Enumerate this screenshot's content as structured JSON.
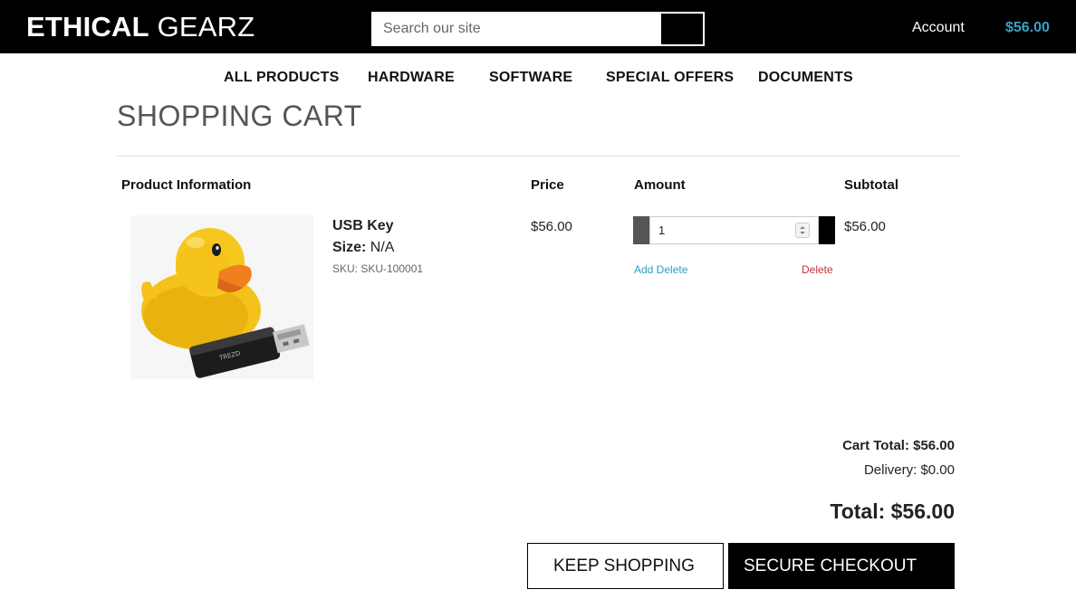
{
  "header": {
    "logo_bold": "ETHICAL",
    "logo_light": "GEARZ",
    "search_placeholder": "Search our site",
    "account_label": "Account",
    "cart_total": "$56.00",
    "accent_color": "#3aa3c4"
  },
  "nav": {
    "items": [
      {
        "label": "ALL PRODUCTS"
      },
      {
        "label": "HARDWARE"
      },
      {
        "label": "SOFTWARE"
      },
      {
        "label": "SPECIAL OFFERS"
      },
      {
        "label": "DOCUMENTS"
      }
    ]
  },
  "page": {
    "title": "SHOPPING CART"
  },
  "table": {
    "headers": {
      "product": "Product Information",
      "price": "Price",
      "amount": "Amount",
      "subtotal": "Subtotal"
    },
    "rows": [
      {
        "name": "USB Key",
        "size_label": "Size:",
        "size_value": "N/A",
        "sku": "SKU: SKU-100001",
        "price": "$56.00",
        "quantity": "1",
        "subtotal": "$56.00",
        "add_delete_label": "Add Delete",
        "delete_label": "Delete",
        "image_icon": "rubber-duck-usb-key-image"
      }
    ]
  },
  "totals": {
    "cart_total": "Cart Total: $56.00",
    "delivery": "Delivery: $0.00",
    "total": "Total: $56.00"
  },
  "buttons": {
    "keep_shopping": "KEEP SHOPPING",
    "secure_checkout": "SECURE CHECKOUT"
  },
  "colors": {
    "link_blue": "#2a9fbf",
    "delete_red": "#c8343a"
  }
}
